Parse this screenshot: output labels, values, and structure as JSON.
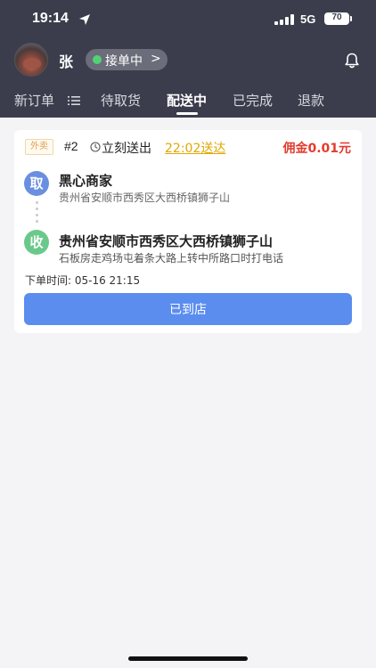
{
  "status_bar": {
    "time": "19:14",
    "network": "5G",
    "battery": "70"
  },
  "header": {
    "user_name": "张",
    "status": "接单中"
  },
  "tabs": [
    {
      "label": "新订单"
    },
    {
      "label": "待取货"
    },
    {
      "label": "配送中"
    },
    {
      "label": "已完成"
    },
    {
      "label": "退款"
    }
  ],
  "order": {
    "tag": "外卖",
    "number": "#2",
    "delivery_mode": "立刻送出",
    "delivery_time": "22:02送达",
    "commission": "佣金0.01元",
    "pickup_badge": "取",
    "pickup_name": "黑心商家",
    "pickup_address": "贵州省安顺市西秀区大西桥镇狮子山",
    "receive_badge": "收",
    "receive_title": "贵州省安顺市西秀区大西桥镇狮子山",
    "receive_address": "石板房走鸡场屯着条大路上转中所路口时打电话",
    "order_time": "下单时间: 05-16 21:15",
    "action_label": "已到店"
  },
  "colors": {
    "header_bg": "#3b3d4c",
    "primary": "#5b8def",
    "commission": "#e23b2e",
    "online": "#52d273"
  }
}
